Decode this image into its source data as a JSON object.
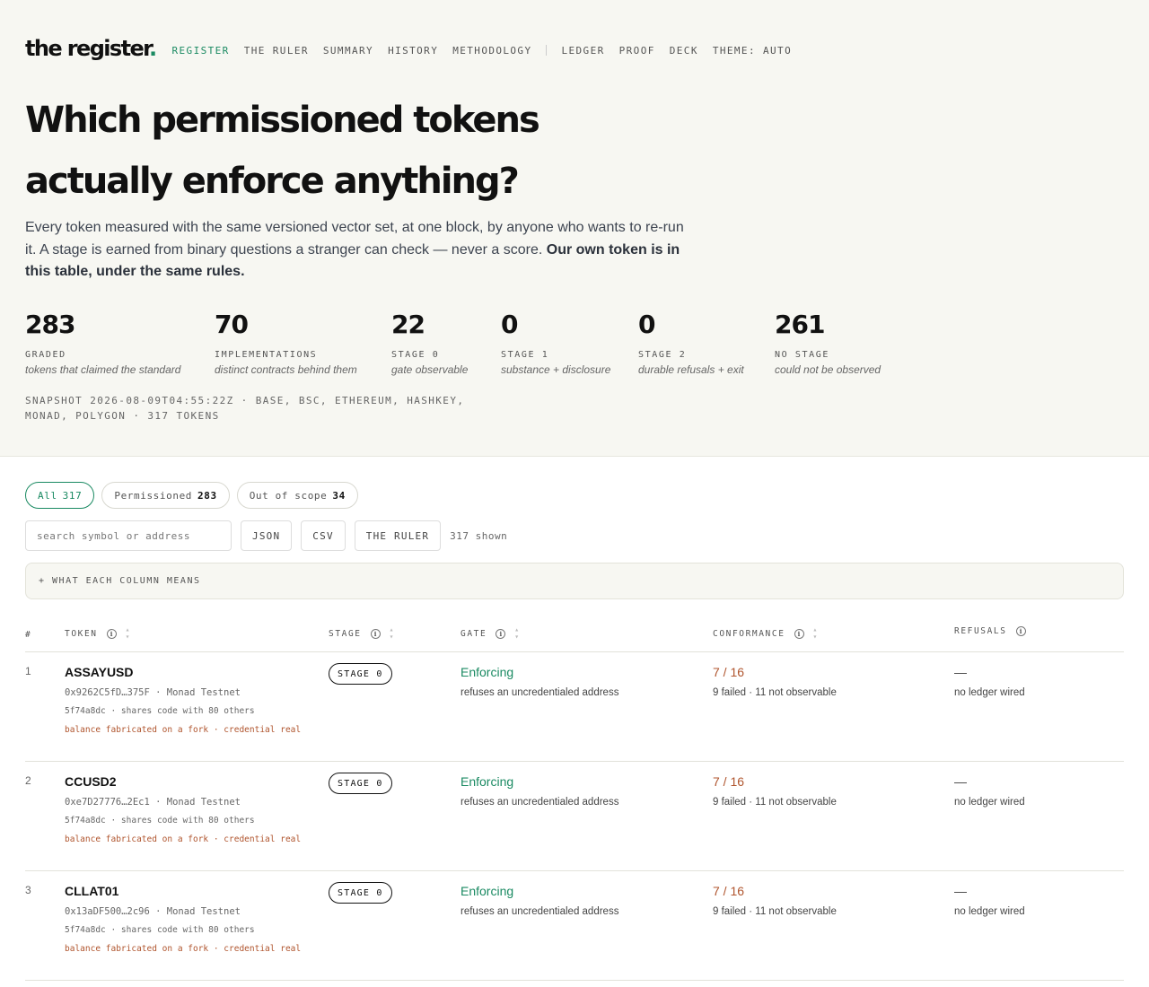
{
  "brand": {
    "name": "the register",
    "dot": "."
  },
  "nav": {
    "items": [
      "REGISTER",
      "THE RULER",
      "SUMMARY",
      "HISTORY",
      "METHODOLOGY"
    ],
    "items2": [
      "LEDGER",
      "PROOF",
      "DECK",
      "THEME: AUTO"
    ]
  },
  "hero": {
    "title_line1": "Which permissioned tokens",
    "title_line2": "actually enforce anything?",
    "lede": "Every token measured with the same versioned vector set, at one block, by anyone who wants to re-run it. A stage is earned from binary questions a stranger can check — never a score.",
    "lede_bold": "Our own token is in this table, under the same rules."
  },
  "stats": [
    {
      "num": "283",
      "label": "GRADED",
      "sub": "tokens that claimed the standard"
    },
    {
      "num": "70",
      "label": "IMPLEMENTATIONS",
      "sub": "distinct contracts behind them"
    },
    {
      "num": "22",
      "label": "STAGE 0",
      "sub": "gate observable"
    },
    {
      "num": "0",
      "label": "STAGE 1",
      "sub": "substance + disclosure"
    },
    {
      "num": "0",
      "label": "STAGE 2",
      "sub": "durable refusals + exit"
    },
    {
      "num": "261",
      "label": "NO STAGE",
      "sub": "could not be observed"
    }
  ],
  "snapshot": {
    "line1": "SNAPSHOT 2026-08-09T04:55:22Z · BASE, BSC, ETHEREUM, HASHKEY,",
    "line2": "MONAD, POLYGON · 317 TOKENS"
  },
  "filters": [
    {
      "label": "All",
      "count": "317"
    },
    {
      "label": "Permissioned",
      "count": "283"
    },
    {
      "label": "Out of scope",
      "count": "34"
    }
  ],
  "toolbar": {
    "search_placeholder": "search symbol or address",
    "json_label": "JSON",
    "csv_label": "CSV",
    "ruler_label": "THE RULER",
    "shown": "317 shown"
  },
  "column_info": "+ WHAT EACH COLUMN MEANS",
  "table": {
    "headers": {
      "idx": "#",
      "token": "TOKEN",
      "stage": "STAGE",
      "gate": "GATE",
      "conformance": "CONFORMANCE",
      "refusals": "REFUSALS"
    },
    "rows": [
      {
        "idx": "1",
        "symbol": "ASSAYUSD",
        "addr": "0x9262C5fD…375F · Monad Testnet",
        "code": "5f74a8dc · shares code with 80 others",
        "flag": "balance fabricated on a fork · credential real",
        "stage": "STAGE 0",
        "gate": "Enforcing",
        "gate_sub": "refuses an uncredentialed address",
        "conf": "7 / 16",
        "conf_sub": "9 failed · 11 not observable",
        "ref": "—",
        "ref_sub": "no ledger wired"
      },
      {
        "idx": "2",
        "symbol": "CCUSD2",
        "addr": "0xe7D27776…2Ec1 · Monad Testnet",
        "code": "5f74a8dc · shares code with 80 others",
        "flag": "balance fabricated on a fork · credential real",
        "stage": "STAGE 0",
        "gate": "Enforcing",
        "gate_sub": "refuses an uncredentialed address",
        "conf": "7 / 16",
        "conf_sub": "9 failed · 11 not observable",
        "ref": "—",
        "ref_sub": "no ledger wired"
      },
      {
        "idx": "3",
        "symbol": "CLLAT01",
        "addr": "0x13aDF500…2c96 · Monad Testnet",
        "code": "5f74a8dc · shares code with 80 others",
        "flag": "balance fabricated on a fork · credential real",
        "stage": "STAGE 0",
        "gate": "Enforcing",
        "gate_sub": "refuses an uncredentialed address",
        "conf": "7 / 16",
        "conf_sub": "9 failed · 11 not observable",
        "ref": "—",
        "ref_sub": "no ledger wired"
      }
    ]
  },
  "colors": {
    "accent": "#1a8a62",
    "warn": "#b0552e",
    "hero_bg": "#f7f7f2"
  }
}
